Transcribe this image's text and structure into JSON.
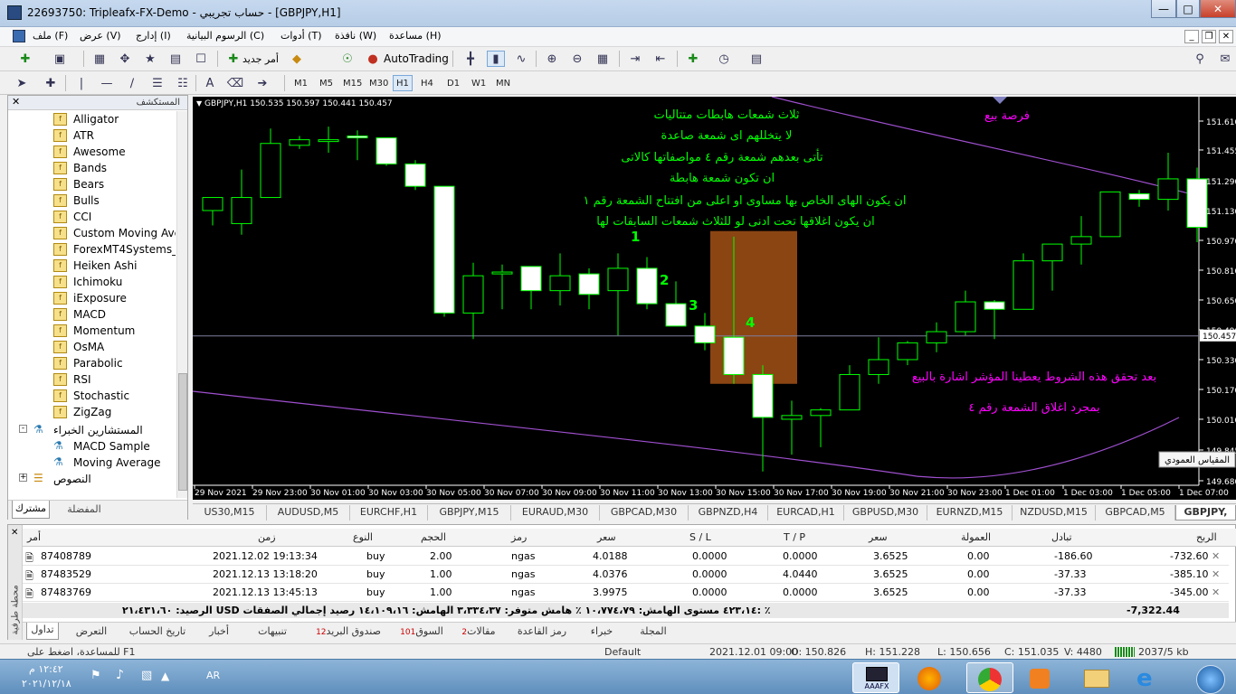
{
  "window": {
    "title": "22693750: Tripleafx-FX-Demo - حساب تجريبي - [GBPJPY,H1]"
  },
  "menu": {
    "items": [
      "ملف (F)",
      "عرض (V)",
      "إدارج (I)",
      "الرسوم البيانية (C)",
      "أدوات (T)",
      "نافذة (W)",
      "مساعدة (H)"
    ]
  },
  "toolbar": {
    "new_order": "أمر جديد",
    "autotrading": "AutoTrading"
  },
  "timeframes": [
    "M1",
    "M5",
    "M15",
    "M30",
    "H1",
    "H4",
    "D1",
    "W1",
    "MN"
  ],
  "navigator": {
    "title": "المستكشف",
    "indicators": [
      "Alligator",
      "ATR",
      "Awesome",
      "Bands",
      "Bears",
      "Bulls",
      "CCI",
      "Custom Moving Ave",
      "ForexMT4Systems_G",
      "Heiken Ashi",
      "Ichimoku",
      "iExposure",
      "MACD",
      "Momentum",
      "OsMA",
      "Parabolic",
      "RSI",
      "Stochastic",
      "ZigZag"
    ],
    "experts_group": "المستشارين الخبراء",
    "experts": [
      "MACD Sample",
      "Moving Average"
    ],
    "scripts_group": "النصوص",
    "tabs": [
      "مشترك",
      "المفضلة"
    ]
  },
  "chart": {
    "header": "GBPJPY,H1  150.535 150.597 150.441 150.457",
    "current_price": "150.457",
    "price_labels": [
      "151.610",
      "151.455",
      "151.290",
      "151.130",
      "150.970",
      "150.810",
      "150.650",
      "150.490",
      "150.330",
      "150.170",
      "150.010",
      "149.845",
      "149.680"
    ],
    "time_labels": [
      "29 Nov 2021",
      "29 Nov 23:00",
      "30 Nov 01:00",
      "30 Nov 03:00",
      "30 Nov 05:00",
      "30 Nov 07:00",
      "30 Nov 09:00",
      "30 Nov 11:00",
      "30 Nov 13:00",
      "30 Nov 15:00",
      "30 Nov 17:00",
      "30 Nov 19:00",
      "30 Nov 21:00",
      "30 Nov 23:00",
      "1 Dec 01:00",
      "1 Dec 03:00",
      "1 Dec 05:00",
      "1 Dec 07:00"
    ],
    "annotations": {
      "green_lines": [
        "ثلاث شمعات هابطات متتاليات",
        "لا يتخللهم اى شمعة صاعدة",
        "تأتى بعدهم شمعة رقم ٤ مواصفاتها كالاتى",
        "ان تكون شمعة هابطة",
        "ان يكون الهاى الخاص بها مساوى او اعلى من افتتاح الشمعة رقم ١",
        "ان يكون اغلاقها تحت ادنى لو للثلاث شمعات السابقات لها"
      ],
      "sell_label": "فرصة بيع",
      "magenta_lines": [
        "بعد تحقق هذه الشروط يعطينا المؤشر اشارة بالبيع",
        "بمجرد اغلاق الشمعة رقم ٤"
      ],
      "numbers": [
        "1",
        "2",
        "3",
        "4"
      ]
    },
    "tooltip": "المقياس العمودي",
    "colors": {
      "bull": "#000000",
      "bear": "#ffffff",
      "wick": "#00ff00",
      "highlight": "#8b4513",
      "green_text": "#00ff00",
      "magenta_text": "#ff00ff",
      "ma_line": "#a050d0",
      "grid_line": "#8080a0"
    },
    "candles": [
      {
        "o": 151.13,
        "h": 151.2,
        "l": 151.05,
        "c": 151.2
      },
      {
        "o": 151.06,
        "h": 151.35,
        "l": 151.0,
        "c": 151.2
      },
      {
        "o": 151.2,
        "h": 151.57,
        "l": 151.2,
        "c": 151.49
      },
      {
        "o": 151.48,
        "h": 151.53,
        "l": 151.46,
        "c": 151.51
      },
      {
        "o": 151.51,
        "h": 151.58,
        "l": 151.44,
        "c": 151.51
      },
      {
        "o": 151.53,
        "h": 151.56,
        "l": 151.4,
        "c": 151.52
      },
      {
        "o": 151.52,
        "h": 151.52,
        "l": 151.37,
        "c": 151.38
      },
      {
        "o": 151.38,
        "h": 151.4,
        "l": 151.24,
        "c": 151.26
      },
      {
        "o": 151.26,
        "h": 151.26,
        "l": 150.56,
        "c": 150.58
      },
      {
        "o": 150.58,
        "h": 150.85,
        "l": 150.44,
        "c": 150.78
      },
      {
        "o": 150.79,
        "h": 150.84,
        "l": 150.6,
        "c": 150.8
      },
      {
        "o": 150.83,
        "h": 150.83,
        "l": 150.6,
        "c": 150.7
      },
      {
        "o": 150.7,
        "h": 150.9,
        "l": 150.62,
        "c": 150.78
      },
      {
        "o": 150.79,
        "h": 150.82,
        "l": 150.6,
        "c": 150.68
      },
      {
        "o": 150.7,
        "h": 150.9,
        "l": 150.46,
        "c": 150.82
      },
      {
        "o": 150.82,
        "h": 150.88,
        "l": 150.6,
        "c": 150.63
      },
      {
        "o": 150.63,
        "h": 150.75,
        "l": 150.57,
        "c": 150.51
      },
      {
        "o": 150.51,
        "h": 150.58,
        "l": 150.38,
        "c": 150.42
      },
      {
        "o": 150.45,
        "h": 150.99,
        "l": 150.2,
        "c": 150.25
      },
      {
        "o": 150.25,
        "h": 150.3,
        "l": 149.73,
        "c": 150.02
      },
      {
        "o": 150.01,
        "h": 150.11,
        "l": 149.82,
        "c": 150.03
      },
      {
        "o": 150.03,
        "h": 150.07,
        "l": 149.86,
        "c": 150.06
      },
      {
        "o": 150.06,
        "h": 150.3,
        "l": 150.06,
        "c": 150.25
      },
      {
        "o": 150.25,
        "h": 150.45,
        "l": 150.2,
        "c": 150.33
      },
      {
        "o": 150.33,
        "h": 150.43,
        "l": 150.3,
        "c": 150.42
      },
      {
        "o": 150.42,
        "h": 150.53,
        "l": 150.37,
        "c": 150.48
      },
      {
        "o": 150.48,
        "h": 150.7,
        "l": 150.46,
        "c": 150.64
      },
      {
        "o": 150.64,
        "h": 150.65,
        "l": 150.44,
        "c": 150.6
      },
      {
        "o": 150.6,
        "h": 150.9,
        "l": 150.6,
        "c": 150.86
      },
      {
        "o": 150.86,
        "h": 150.95,
        "l": 150.7,
        "c": 150.95
      },
      {
        "o": 150.95,
        "h": 151.1,
        "l": 150.84,
        "c": 150.99
      },
      {
        "o": 150.99,
        "h": 151.23,
        "l": 150.99,
        "c": 151.23
      },
      {
        "o": 151.22,
        "h": 151.24,
        "l": 151.15,
        "c": 151.19
      },
      {
        "o": 151.19,
        "h": 151.44,
        "l": 151.13,
        "c": 151.3
      },
      {
        "o": 151.3,
        "h": 151.36,
        "l": 150.96,
        "c": 151.04
      }
    ]
  },
  "chart_tabs": [
    "US30,M15",
    "AUDUSD,M5",
    "EURCHF,H1",
    "GBPJPY,M15",
    "EURAUD,M30",
    "GBPCAD,M30",
    "GBPNZD,H4",
    "EURCAD,H1",
    "GBPUSD,M30",
    "EURNZD,M15",
    "NZDUSD,M15",
    "GBPCAD,M5",
    "GBPJPY,"
  ],
  "terminal": {
    "headers": [
      "أمر",
      "زمن",
      "النوع",
      "الحجم",
      "رمز",
      "سعر",
      "S / L",
      "T / P",
      "سعر",
      "العمولة",
      "تبادل",
      "الربح"
    ],
    "rows": [
      [
        "87408789",
        "2021.12.02 19:13:34",
        "buy",
        "2.00",
        "ngas",
        "4.0188",
        "0.0000",
        "0.0000",
        "3.6525",
        "0.00",
        "-186.60",
        "-732.60"
      ],
      [
        "87483529",
        "2021.12.13 13:18:20",
        "buy",
        "1.00",
        "ngas",
        "4.0376",
        "0.0000",
        "4.0440",
        "3.6525",
        "0.00",
        "-37.33",
        "-385.10"
      ],
      [
        "87483769",
        "2021.12.13 13:45:13",
        "buy",
        "1.00",
        "ngas",
        "3.9975",
        "0.0000",
        "0.0000",
        "3.6525",
        "0.00",
        "-37.33",
        "-345.00"
      ]
    ],
    "summary": "الرصيد: ٢١،٤٣١،٦٠ USD  ٤٢٣،١٤  مستوى الهامش: ١٠،٧٧٤،٧٩ ٪  هامش متوفر: ٣،٣٣٤،٣٧  الهامش: ١٤،١٠٩،١٦  رصيد إجمالي الصفقات: ٪",
    "total_profit": "-7,322.44",
    "tabs": [
      {
        "label": "تداول",
        "badge": ""
      },
      {
        "label": "التعرض",
        "badge": ""
      },
      {
        "label": "تاريخ الحساب",
        "badge": ""
      },
      {
        "label": "أخبار",
        "badge": ""
      },
      {
        "label": "تنبيهات",
        "badge": ""
      },
      {
        "label": "صندوق البريد",
        "badge": "12"
      },
      {
        "label": "السوق",
        "badge": "101"
      },
      {
        "label": "مقالات",
        "badge": "2"
      },
      {
        "label": "رمز القاعدة",
        "badge": ""
      },
      {
        "label": "خبراء",
        "badge": ""
      },
      {
        "label": "المجلة",
        "badge": ""
      }
    ],
    "side_label": "محطة طرفية"
  },
  "status": {
    "help": "للمساعدة، اضغط على F1",
    "profile": "Default",
    "time": "2021.12.01 09:00",
    "open": "O: 150.826",
    "high": "H: 151.228",
    "low": "L: 150.656",
    "close": "C: 151.035",
    "volume": "V: 4480",
    "traffic": "2037/5 kb"
  },
  "taskbar": {
    "lang": "AR",
    "time": "١٢:٤٢ م",
    "date": "٢٠٢١/١٢/١٨",
    "mt4_label": "AAAFX"
  }
}
